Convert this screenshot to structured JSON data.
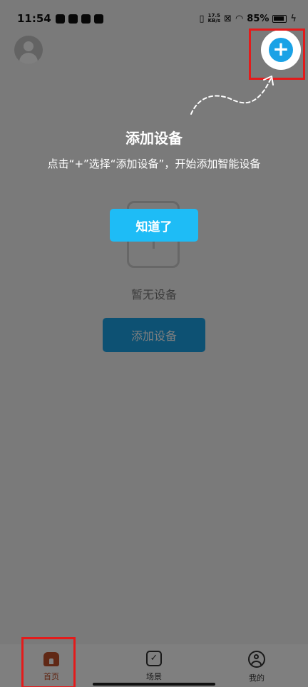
{
  "status_bar": {
    "time": "11:54",
    "net_speed_value": "17.5",
    "net_speed_unit": "KB/s",
    "battery": "85%"
  },
  "empty_state": {
    "text": "暂无设备",
    "add_button_label": "添加设备"
  },
  "guide": {
    "title": "添加设备",
    "description": "点击“+”选择“添加设备”，开始添加智能设备",
    "got_it_label": "知道了",
    "plus_glyph": "+"
  },
  "bottom_nav": {
    "items": [
      {
        "label": "首页",
        "icon": "home-icon",
        "active": true
      },
      {
        "label": "场景",
        "icon": "scene-icon",
        "active": false
      },
      {
        "label": "我的",
        "icon": "profile-icon",
        "active": false
      }
    ]
  },
  "colors": {
    "accent": "#1aa2e6",
    "guide_button": "#1ebcf6",
    "active_tab": "#c0502a",
    "highlight_frame": "#e31b1b",
    "overlay": "rgba(0,0,0,0.5)"
  }
}
